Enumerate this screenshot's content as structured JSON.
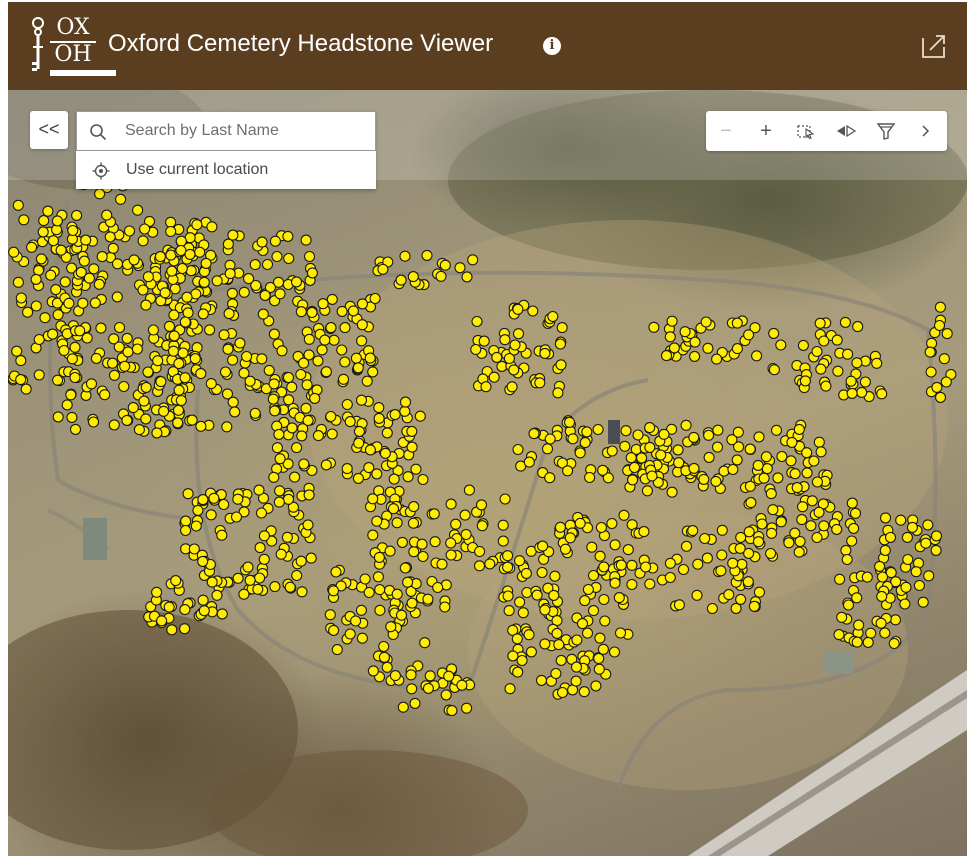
{
  "header": {
    "logo_top": "OX",
    "logo_bottom": "OH",
    "title": "Oxford Cemetery Headstone Viewer",
    "info_icon": "info-icon",
    "share_icon": "share-icon",
    "background_color": "#5a3e1f"
  },
  "search": {
    "collapse_label": "<<",
    "placeholder": "Search by Last Name",
    "value": "",
    "suggestion_label": "Use current location"
  },
  "toolbar": {
    "zoom_out_label": "−",
    "zoom_in_label": "+",
    "buttons": [
      "zoom-out-icon",
      "zoom-in-icon",
      "select-icon",
      "swipe-icon",
      "filter-icon",
      "chevron-right-icon"
    ]
  },
  "map": {
    "marker_color": "#ffec00",
    "marker_outline": "#1a1a1a"
  }
}
